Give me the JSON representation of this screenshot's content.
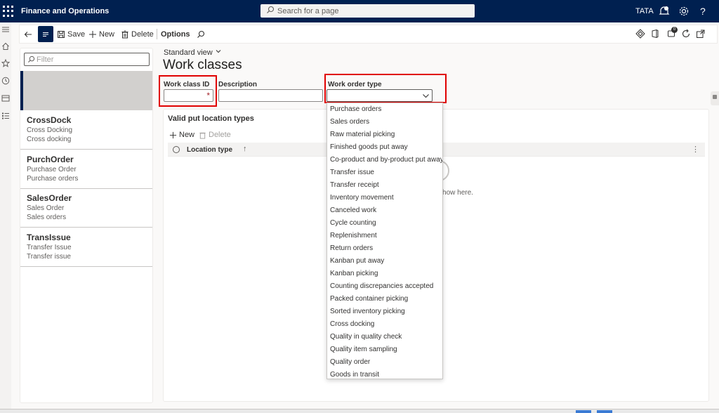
{
  "header": {
    "app_title": "Finance and Operations",
    "search_placeholder": "Search for a page",
    "company": "TATA",
    "help_label": "?",
    "notifications_badge": "1"
  },
  "actions": {
    "save": "Save",
    "new": "New",
    "delete": "Delete",
    "options": "Options",
    "messages_badge": "0"
  },
  "list": {
    "filter_placeholder": "Filter",
    "items": [
      {
        "title": "CrossDock",
        "line1": "Cross Docking",
        "line2": "Cross docking"
      },
      {
        "title": "PurchOrder",
        "line1": "Purchase Order",
        "line2": "Purchase orders"
      },
      {
        "title": "SalesOrder",
        "line1": "Sales Order",
        "line2": "Sales orders"
      },
      {
        "title": "TransIssue",
        "line1": "Transfer Issue",
        "line2": "Transfer issue"
      }
    ]
  },
  "form": {
    "view_name": "Standard view",
    "title": "Work classes",
    "work_class_id_label": "Work class ID",
    "work_class_id_required": "*",
    "description_label": "Description",
    "work_order_type_label": "Work order type"
  },
  "section": {
    "title": "Valid put location types",
    "new": "New",
    "delete": "Delete",
    "column_location_type": "Location type",
    "sort_arrow": "↑",
    "more": "⋮",
    "empty_message": "ng to show here."
  },
  "dropdown": {
    "options": [
      "Purchase orders",
      "Sales orders",
      "Raw material picking",
      "Finished goods put away",
      "Co-product and by-product put away",
      "Transfer issue",
      "Transfer receipt",
      "Inventory movement",
      "Canceled work",
      "Cycle counting",
      "Replenishment",
      "Return orders",
      "Kanban put away",
      "Kanban picking",
      "Counting discrepancies accepted",
      "Packed container picking",
      "Sorted inventory picking",
      "Cross docking",
      "Quality in quality check",
      "Quality item sampling",
      "Quality order",
      "Goods in transit"
    ]
  },
  "colors": {
    "header_bg": "#002050",
    "highlight": "#e00000",
    "selected_row": "#d2d0ce"
  }
}
